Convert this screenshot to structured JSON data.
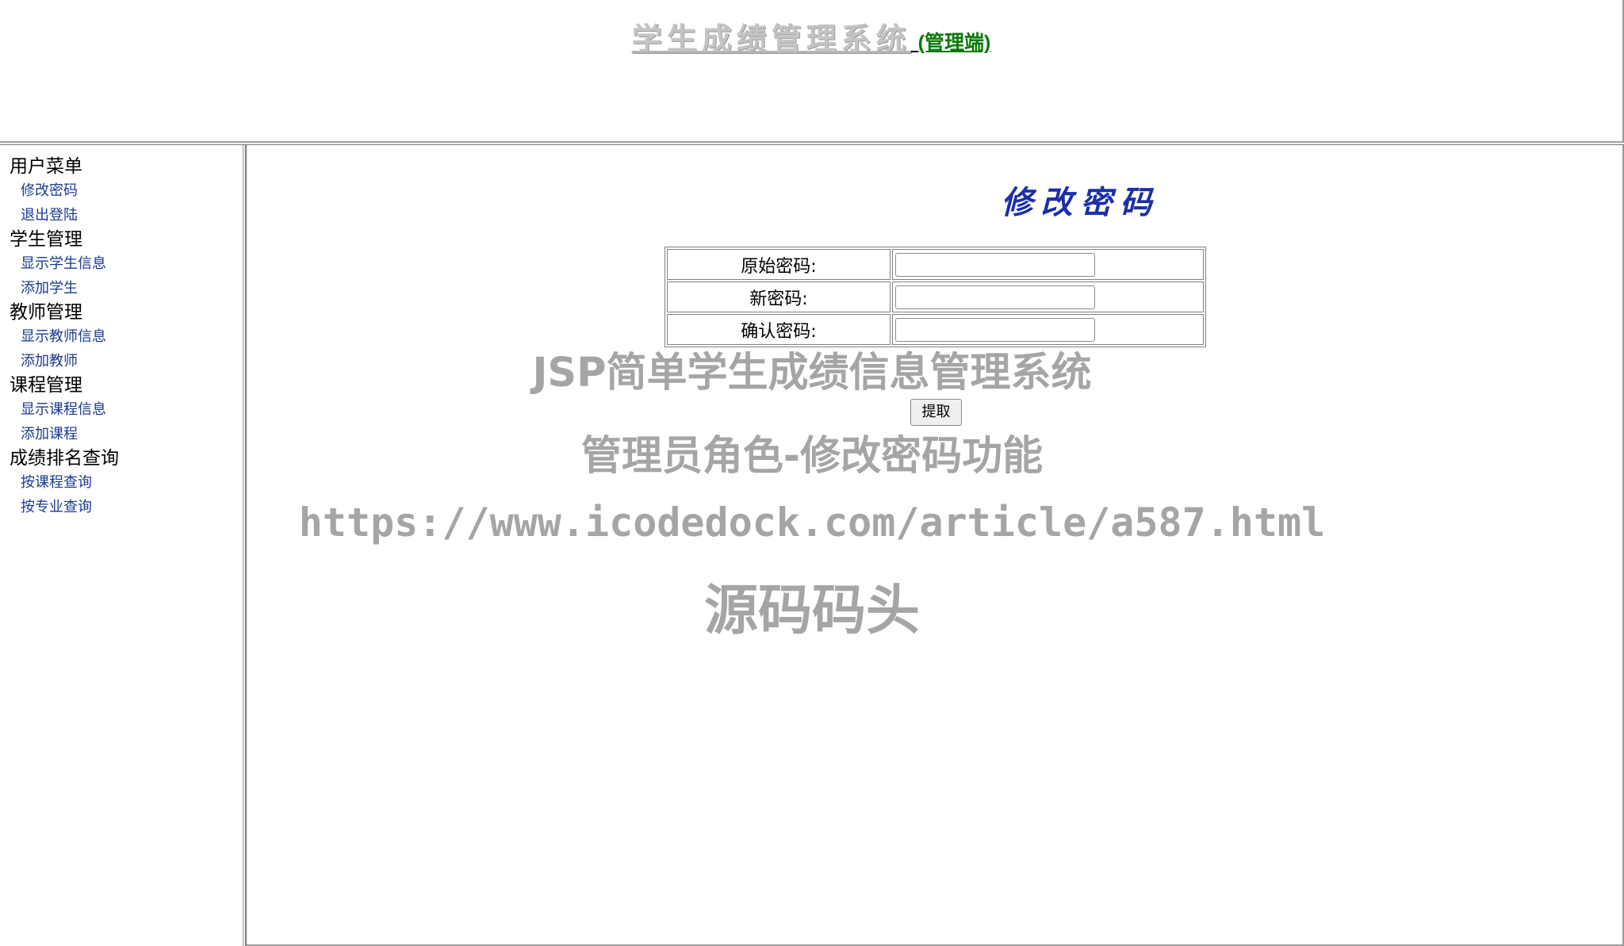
{
  "header": {
    "title": "学生成绩管理系统",
    "spacer": " ",
    "subtitle": "(管理端)"
  },
  "sidebar": {
    "groups": [
      {
        "title": "用户菜单",
        "items": [
          "修改密码",
          "退出登陆"
        ]
      },
      {
        "title": "学生管理",
        "items": [
          "显示学生信息",
          "添加学生"
        ]
      },
      {
        "title": "教师管理",
        "items": [
          "显示教师信息",
          "添加教师"
        ]
      },
      {
        "title": "课程管理",
        "items": [
          "显示课程信息",
          "添加课程"
        ]
      },
      {
        "title": "成绩排名查询",
        "items": [
          "按课程查询",
          "按专业查询"
        ]
      }
    ]
  },
  "main": {
    "title": "修改密码",
    "form": {
      "old_password_label": "原始密码:",
      "old_password_value": "",
      "new_password_label": "新密码:",
      "new_password_value": "",
      "confirm_password_label": "确认密码:",
      "confirm_password_value": "",
      "submit_label": "提取"
    }
  },
  "watermark": {
    "line1": "JSP简单学生成绩信息管理系统",
    "line2": "管理员角色-修改密码功能",
    "line3": "https://www.icodedock.com/article/a587.html",
    "line4": "源码码头"
  },
  "colors": {
    "menu_link": "#1a3a8f",
    "page_title": "#1c2fa8",
    "header_subtitle": "#0a7a0a",
    "header_title": "#c4c4c4"
  }
}
